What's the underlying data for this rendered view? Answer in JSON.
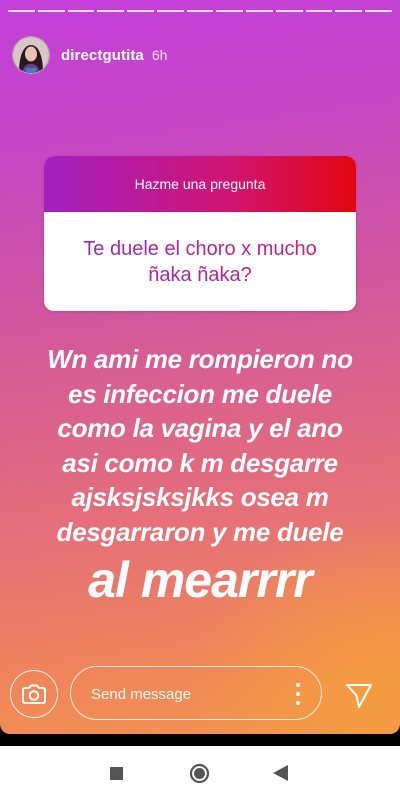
{
  "story": {
    "username": "directgutita",
    "time_ago": "6h",
    "progress_segments": 13
  },
  "question": {
    "header": "Hazme una pregunta",
    "text": "Te duele el choro x mucho ñaka ñaka?"
  },
  "answer": {
    "lines": [
      "Wn ami me rompieron no",
      "es infeccion me duele",
      "como la vagina y el ano",
      "asi como k m desgarre",
      "ajsksjsksjkks osea m",
      "desgarraron y me duele"
    ],
    "last_line": "al mearrrr"
  },
  "reply_bar": {
    "placeholder": "Send message"
  },
  "icons": {
    "camera": "camera-icon",
    "more": "more-vertical-icon",
    "send": "send-icon",
    "nav_recents": "square-icon",
    "nav_home": "circle-icon",
    "nav_back": "back-triangle-icon"
  },
  "colors": {
    "question_header_start": "#a220c2",
    "question_header_end": "#e2060f",
    "question_text": "#b02aa0"
  }
}
